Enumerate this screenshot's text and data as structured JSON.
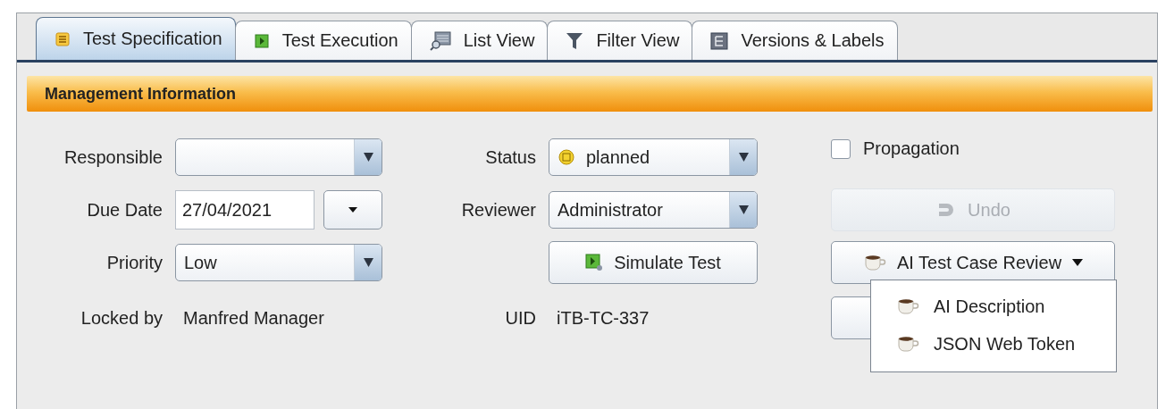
{
  "tabs": [
    {
      "label": "Test Specification",
      "selected": true
    },
    {
      "label": "Test Execution",
      "selected": false
    },
    {
      "label": "List View",
      "selected": false
    },
    {
      "label": "Filter View",
      "selected": false
    },
    {
      "label": "Versions & Labels",
      "selected": false
    }
  ],
  "section": {
    "title": "Management Information"
  },
  "responsible": {
    "label": "Responsible"
  },
  "due_date": {
    "label": "Due Date",
    "value": "27/04/2021"
  },
  "priority": {
    "label": "Priority",
    "value": "Low"
  },
  "locked_by": {
    "label": "Locked by",
    "value": "Manfred Manager"
  },
  "status": {
    "label": "Status",
    "value": "planned"
  },
  "reviewer": {
    "label": "Reviewer",
    "value": "Administrator"
  },
  "uid": {
    "label": "UID",
    "value": "iTB-TC-337"
  },
  "simulate_button": {
    "label": "Simulate Test"
  },
  "propagation": {
    "label": "Propagation",
    "checked": false
  },
  "undo_button": {
    "label": "Undo",
    "disabled": true
  },
  "ai_menu_button": {
    "label": "AI Test Case Review",
    "expanded": true
  },
  "ai_menu": {
    "items": [
      "AI Description",
      "JSON Web Token"
    ]
  }
}
